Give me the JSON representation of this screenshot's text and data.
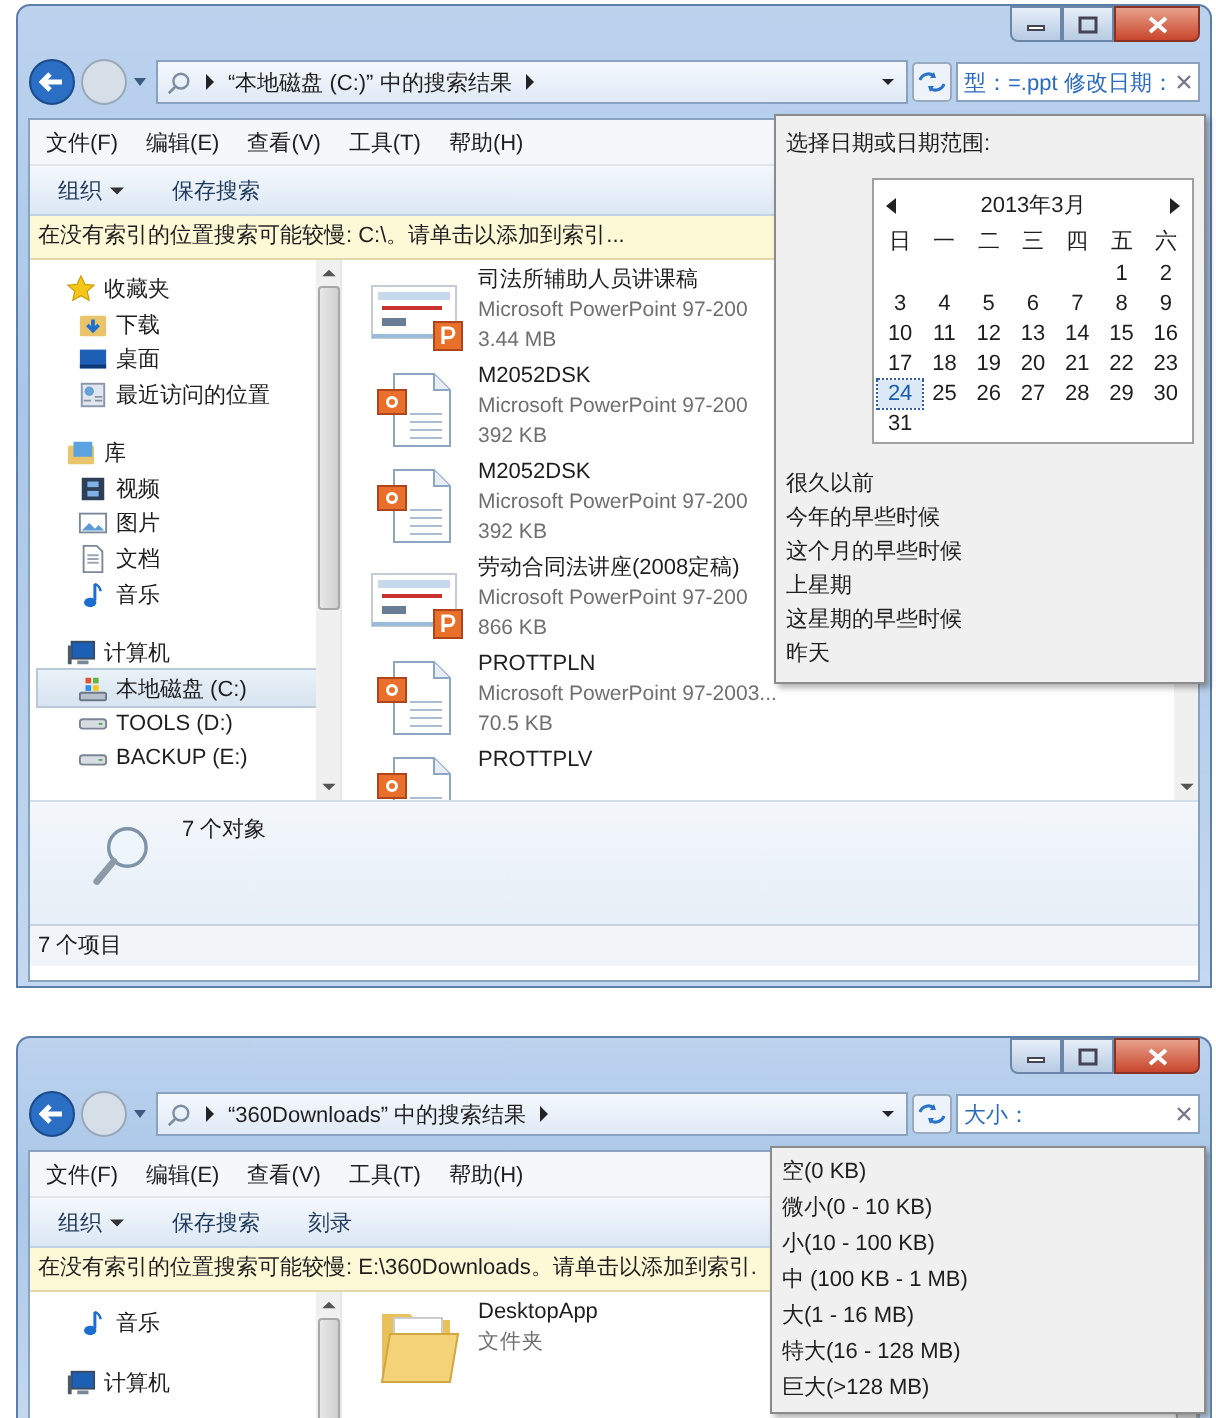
{
  "windows": [
    {
      "breadcrumb": "“本地磁盘 (C:)” 中的搜索结果",
      "search": {
        "value": "型：=.ppt 修改日期："
      },
      "menu": [
        "文件(F)",
        "编辑(E)",
        "查看(V)",
        "工具(T)",
        "帮助(H)"
      ],
      "toolbar": [
        {
          "label": "组织",
          "dropdown": true
        },
        {
          "label": "保存搜索",
          "dropdown": false
        }
      ],
      "info_bar": "在没有索引的位置搜索可能较慢: C:\\。请单击以添加到索引...",
      "nav": [
        {
          "label": "收藏夹",
          "kind": "star",
          "children": [
            {
              "label": "下载",
              "kind": "download",
              "selected": false
            },
            {
              "label": "桌面",
              "kind": "desktop",
              "selected": false
            },
            {
              "label": "最近访问的位置",
              "kind": "recent",
              "selected": false
            }
          ]
        },
        {
          "label": "库",
          "kind": "library",
          "children": [
            {
              "label": "视频",
              "kind": "video",
              "selected": false
            },
            {
              "label": "图片",
              "kind": "picture",
              "selected": false
            },
            {
              "label": "文档",
              "kind": "document",
              "selected": false
            },
            {
              "label": "音乐",
              "kind": "music",
              "selected": false
            }
          ]
        },
        {
          "label": "计算机",
          "kind": "computer",
          "children": [
            {
              "label": "本地磁盘 (C:)",
              "kind": "system-drive",
              "selected": true
            },
            {
              "label": "TOOLS (D:)",
              "kind": "drive",
              "selected": false
            },
            {
              "label": "BACKUP (E:)",
              "kind": "drive",
              "selected": false
            }
          ]
        }
      ],
      "files": [
        {
          "name": "司法所辅助人员讲课稿",
          "type": "Microsoft PowerPoint 97-200",
          "size": "3.44 MB",
          "kind": "slide"
        },
        {
          "name": "M2052DSK",
          "type": "Microsoft PowerPoint 97-200",
          "size": "392 KB",
          "kind": "doc"
        },
        {
          "name": "M2052DSK",
          "type": "Microsoft PowerPoint 97-200",
          "size": "392 KB",
          "kind": "doc"
        },
        {
          "name": "劳动合同法讲座(2008定稿)",
          "type": "Microsoft PowerPoint 97-200",
          "size": "866 KB",
          "kind": "slide"
        },
        {
          "name": "PROTTPLN",
          "type": "Microsoft PowerPoint 97-2003...",
          "size": "70.5 KB",
          "kind": "doc"
        },
        {
          "name": "PROTTPLV",
          "kind": "doc"
        }
      ],
      "details": {
        "count": "7 个对象"
      },
      "status_bar": "7 个项目",
      "popup": {
        "kind": "date",
        "prompt": "选择日期或日期范围:",
        "month": "2013年3月",
        "weekdays": [
          "日",
          "一",
          "二",
          "三",
          "四",
          "五",
          "六"
        ],
        "weeks": [
          [
            {
              "day": "1",
              "selected": false
            },
            {
              "day": "2",
              "selected": false
            }
          ],
          [
            {
              "day": "3",
              "selected": false
            },
            {
              "day": "4",
              "selected": false
            },
            {
              "day": "5",
              "selected": false
            },
            {
              "day": "6",
              "selected": false
            },
            {
              "day": "7",
              "selected": false
            },
            {
              "day": "8",
              "selected": false
            },
            {
              "day": "9",
              "selected": false
            }
          ],
          [
            {
              "day": "10",
              "selected": false
            },
            {
              "day": "11",
              "selected": false
            },
            {
              "day": "12",
              "selected": false
            },
            {
              "day": "13",
              "selected": false
            },
            {
              "day": "14",
              "selected": false
            },
            {
              "day": "15",
              "selected": false
            },
            {
              "day": "16",
              "selected": false
            }
          ],
          [
            {
              "day": "17",
              "selected": false
            },
            {
              "day": "18",
              "selected": false
            },
            {
              "day": "19",
              "selected": false
            },
            {
              "day": "20",
              "selected": false
            },
            {
              "day": "21",
              "selected": false
            },
            {
              "day": "22",
              "selected": false
            },
            {
              "day": "23",
              "selected": false
            }
          ],
          [
            {
              "day": "24",
              "selected": true
            },
            {
              "day": "25",
              "selected": false
            },
            {
              "day": "26",
              "selected": false
            },
            {
              "day": "27",
              "selected": false
            },
            {
              "day": "28",
              "selected": false
            },
            {
              "day": "29",
              "selected": false
            },
            {
              "day": "30",
              "selected": false
            }
          ],
          [
            {
              "day": "31",
              "selected": false
            }
          ]
        ],
        "options": [
          "很久以前",
          "今年的早些时候",
          "这个月的早些时候",
          "上星期",
          "这星期的早些时候",
          "昨天"
        ]
      }
    },
    {
      "breadcrumb": "“360Downloads” 中的搜索结果",
      "search": {
        "value": "大小："
      },
      "menu": [
        "文件(F)",
        "编辑(E)",
        "查看(V)",
        "工具(T)",
        "帮助(H)"
      ],
      "toolbar": [
        {
          "label": "组织",
          "dropdown": true
        },
        {
          "label": "保存搜索",
          "dropdown": false
        },
        {
          "label": "刻录",
          "dropdown": false
        }
      ],
      "info_bar": "在没有索引的位置搜索可能较慢: E:\\360Downloads。请单击以添加到索引.",
      "nav": [
        {
          "children": [
            {
              "label": "音乐",
              "kind": "music",
              "selected": false
            }
          ]
        },
        {
          "label": "计算机",
          "kind": "computer"
        }
      ],
      "files": [
        {
          "name": "DesktopApp",
          "type": "文件夹",
          "kind": "folder"
        }
      ],
      "popup": {
        "kind": "size",
        "options": [
          "空(0 KB)",
          "微小(0 - 10 KB)",
          "小(10 - 100 KB)",
          "中 (100 KB - 1 MB)",
          "大(1 - 16 MB)",
          "特大(16 - 128 MB)",
          "巨大(>128 MB)"
        ]
      }
    }
  ]
}
